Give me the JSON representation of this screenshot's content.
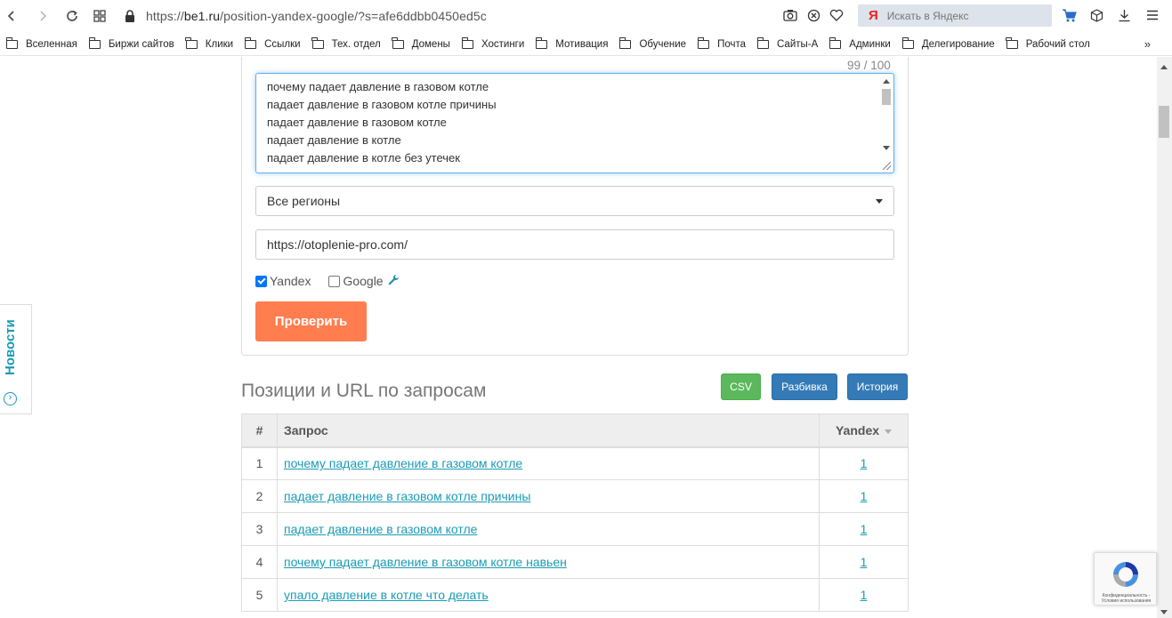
{
  "browser": {
    "url_prefix": "https://",
    "url_host": "be1.ru",
    "url_rest": "/position-yandex-google/?s=afe6ddbb0450ed5c",
    "search_brand": "Я",
    "search_placeholder": "Искать в Яндекс"
  },
  "bookmarks": [
    "Вселенная",
    "Биржи сайтов",
    "Клики",
    "Ссылки",
    "Тех. отдел",
    "Домены",
    "Хостинги",
    "Мотивация",
    "Обучение",
    "Почта",
    "Сайты-А",
    "Админки",
    "Делегирование",
    "Рабочий стол"
  ],
  "bookmarks_more": "»",
  "form": {
    "counter": "99 / 100",
    "queries_lines": [
      "почему падает давление в газовом котле",
      "падает давление в газовом котле причины",
      "падает давление в газовом котле",
      "падает давление в котле",
      "падает давление в котле без утечек"
    ],
    "region": "Все регионы",
    "site_url": "https://otoplenie-pro.com/",
    "engines": [
      {
        "label": "Yandex",
        "checked": true
      },
      {
        "label": "Google",
        "checked": false
      }
    ],
    "submit_label": "Проверить"
  },
  "results": {
    "title": "Позиции и URL по запросам",
    "buttons": {
      "csv": "CSV",
      "split": "Разбивка",
      "history": "История"
    },
    "columns": {
      "num": "#",
      "query": "Запрос",
      "engine": "Yandex"
    },
    "rows": [
      {
        "num": "1",
        "query": "почему падает давление в газовом котле",
        "pos": "1"
      },
      {
        "num": "2",
        "query": "падает давление в газовом котле причины",
        "pos": "1"
      },
      {
        "num": "3",
        "query": "падает давление в газовом котле",
        "pos": "1"
      },
      {
        "num": "4",
        "query": "почему падает давление в газовом котле навьен",
        "pos": "1"
      },
      {
        "num": "5",
        "query": "упало давление в котле что делать",
        "pos": "1"
      }
    ]
  },
  "news_tab": {
    "label": "Новости"
  },
  "recaptcha": {
    "text": "Конфиденциальность - Условия использования"
  },
  "colors": {
    "accent": "#1a9bb5",
    "submit": "#ff7d4f",
    "csv": "#5cb85c",
    "primary": "#337ab7"
  }
}
